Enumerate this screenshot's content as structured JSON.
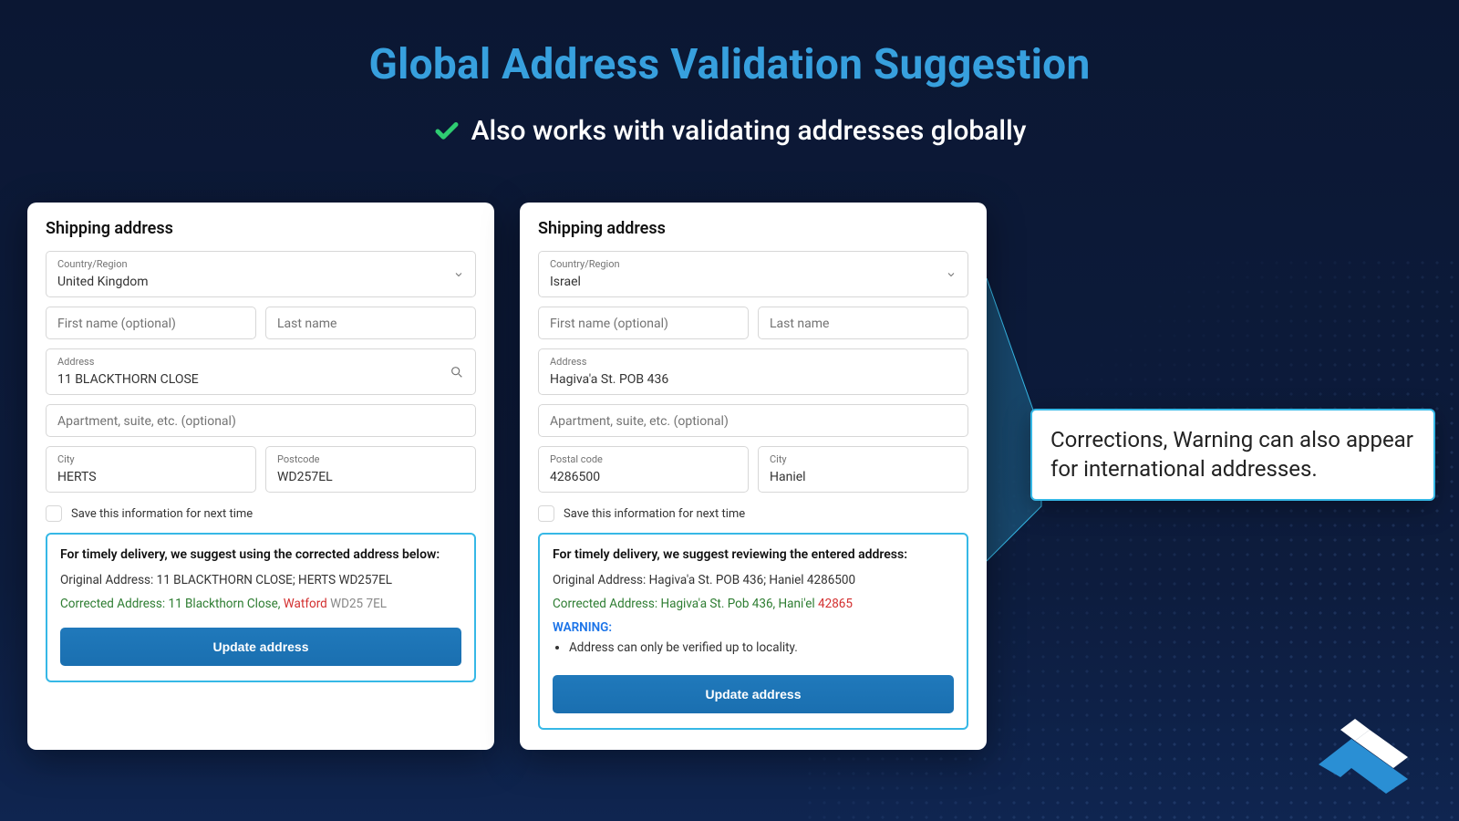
{
  "header": {
    "title": "Global Address Validation Suggestion",
    "subtitle": "Also works with validating addresses globally"
  },
  "shared": {
    "card_title": "Shipping address",
    "country_label": "Country/Region",
    "first_name_placeholder": "First name (optional)",
    "last_name_placeholder": "Last name",
    "address_label": "Address",
    "apt_placeholder": "Apartment, suite, etc. (optional)",
    "save_label": "Save this information for next time",
    "update_button": "Update address",
    "original_prefix": "Original Address:",
    "corrected_prefix": "Corrected Address:"
  },
  "panel_uk": {
    "country_value": "United Kingdom",
    "address_value": "11 BLACKTHORN CLOSE",
    "city_label": "City",
    "city_value": "HERTS",
    "postcode_label": "Postcode",
    "postcode_value": "WD257EL",
    "suggest_heading": "For timely delivery, we suggest using the corrected address below:",
    "original_line": "11 BLACKTHORN CLOSE; HERTS WD257EL",
    "corrected_line_pre": "11 Blackthorn Close, ",
    "corrected_changed": "Watford",
    "corrected_line_post": " WD25 7EL"
  },
  "panel_il": {
    "country_value": "Israel",
    "address_value": "Hagiva'a St. POB 436",
    "postal_label": "Postal code",
    "postal_value": "4286500",
    "city_label": "City",
    "city_value": "Haniel",
    "suggest_heading": "For timely delivery, we suggest reviewing the entered address:",
    "original_line": "Hagiva'a St. POB 436; Haniel 4286500",
    "corrected_line_pre": "Hagiva'a St. Pob 436, Hani'el ",
    "corrected_changed": "42865",
    "warning_label": "WARNING:",
    "warning_item": "Address can only be verified up to locality."
  },
  "callout": {
    "text": "Corrections, Warning can also appear for international addresses."
  }
}
